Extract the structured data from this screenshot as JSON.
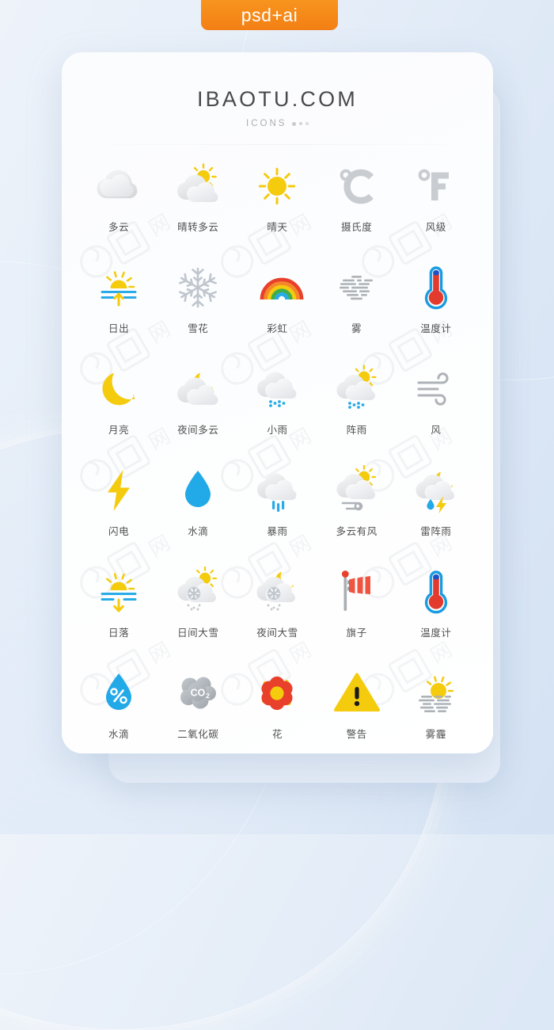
{
  "badge": {
    "label": "psd+ai",
    "color": "#f7941e"
  },
  "card": {
    "brand": "IBAOTU.COM",
    "subtitle": "ICONS"
  },
  "palette": {
    "sun_yellow": "#F5CB0E",
    "sun_yellow_deep": "#F2C200",
    "cloud_light": "#F2F3F5",
    "cloud_gray": "#DEE0E3",
    "rain_blue": "#29ABE8",
    "drop_blue": "#22A9E8",
    "red": "#E8402A",
    "thermo_red": "#E23B2E",
    "thermo_blue": "#1B9BE0",
    "fog_gray": "#AEB3B8",
    "co2_gray": "#B3B8BC",
    "label_text": "#4f4f4f",
    "brand_text": "#4a4a4a",
    "background": "#dde8f6"
  },
  "icons": [
    {
      "name": "cloudy",
      "label": "多云",
      "icon": "cloud"
    },
    {
      "name": "sunny-to-cloudy",
      "label": "晴转多云",
      "icon": "sun-cloud"
    },
    {
      "name": "sunny",
      "label": "晴天",
      "icon": "sun"
    },
    {
      "name": "celsius",
      "label": "摄氏度",
      "icon": "celsius"
    },
    {
      "name": "fahrenheit",
      "label": "风级",
      "icon": "fahrenheit"
    },
    {
      "name": "sunrise",
      "label": "日出",
      "icon": "sunrise"
    },
    {
      "name": "snowflake",
      "label": "雪花",
      "icon": "snowflake"
    },
    {
      "name": "rainbow",
      "label": "彩虹",
      "icon": "rainbow"
    },
    {
      "name": "fog",
      "label": "雾",
      "icon": "fog"
    },
    {
      "name": "thermometer",
      "label": "温度计",
      "icon": "thermometer"
    },
    {
      "name": "moon",
      "label": "月亮",
      "icon": "moon"
    },
    {
      "name": "night-cloudy",
      "label": "夜间多云",
      "icon": "moon-cloud"
    },
    {
      "name": "light-rain",
      "label": "小雨",
      "icon": "cloud-drizzle"
    },
    {
      "name": "shower",
      "label": "阵雨",
      "icon": "sun-cloud-rain"
    },
    {
      "name": "wind",
      "label": "风",
      "icon": "wind"
    },
    {
      "name": "lightning",
      "label": "闪电",
      "icon": "bolt"
    },
    {
      "name": "water-drop",
      "label": "水滴",
      "icon": "drop"
    },
    {
      "name": "heavy-rain",
      "label": "暴雨",
      "icon": "cloud-heavy-rain"
    },
    {
      "name": "cloudy-windy",
      "label": "多云有风",
      "icon": "sun-cloud-wind"
    },
    {
      "name": "thunderstorm",
      "label": "雷阵雨",
      "icon": "moon-cloud-bolt"
    },
    {
      "name": "sunset",
      "label": "日落",
      "icon": "sunset"
    },
    {
      "name": "day-heavy-snow",
      "label": "日间大雪",
      "icon": "sun-cloud-snow"
    },
    {
      "name": "night-heavy-snow",
      "label": "夜间大雪",
      "icon": "moon-cloud-snow"
    },
    {
      "name": "windsock-flag",
      "label": "旗子",
      "icon": "flag"
    },
    {
      "name": "thermometer-2",
      "label": "温度计",
      "icon": "thermometer"
    },
    {
      "name": "humidity",
      "label": "水滴",
      "icon": "drop-percent"
    },
    {
      "name": "carbon-dioxide",
      "label": "二氧化碳",
      "icon": "co2"
    },
    {
      "name": "flower",
      "label": "花",
      "icon": "flower"
    },
    {
      "name": "warning",
      "label": "警告",
      "icon": "warning"
    },
    {
      "name": "haze",
      "label": "雾霾",
      "icon": "sun-haze"
    }
  ],
  "watermarks": {
    "text": "包图网"
  }
}
